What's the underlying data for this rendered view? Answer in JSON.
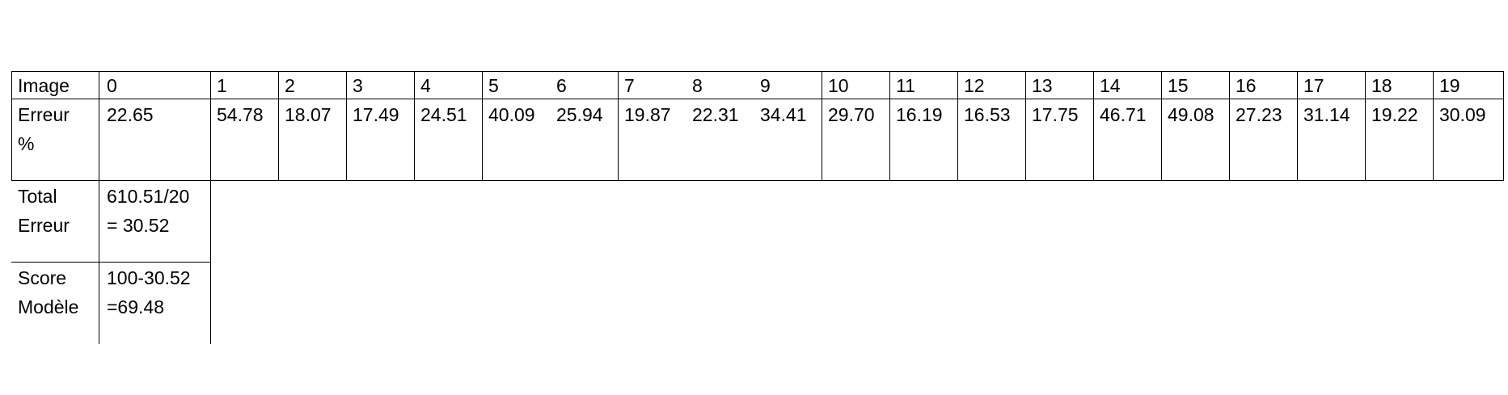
{
  "table": {
    "row_header_image": "Image",
    "row_header_error": "Erreur %",
    "row_header_total_line1": "Total",
    "row_header_total_line2": "Erreur",
    "row_header_score_line1": "Score",
    "row_header_score_line2": "Modèle",
    "image_numbers": [
      "0",
      "1",
      "2",
      "3",
      "4",
      "5",
      "6",
      "7",
      "8",
      "9",
      "10",
      "11",
      "12",
      "13",
      "14",
      "15",
      "16",
      "17",
      "18",
      "19"
    ],
    "error_values": [
      "22.65",
      "54.78",
      "18.07",
      "17.49",
      "24.51",
      "40.09",
      "25.94",
      "19.87",
      "22.31",
      "34.41",
      "29.70",
      "16.19",
      "16.53",
      "17.75",
      "46.71",
      "49.08",
      "27.23",
      "31.14",
      "19.22",
      "30.09"
    ],
    "total_line1": "610.51/20",
    "total_line2": "= 30.52",
    "score_line1": "100-30.52",
    "score_line2": "=69.48"
  }
}
